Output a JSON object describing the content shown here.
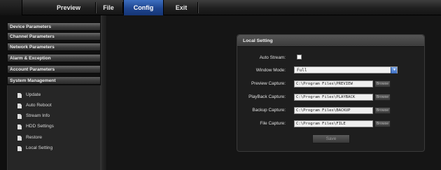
{
  "menu": {
    "items": [
      {
        "label": "Preview"
      },
      {
        "label": "File"
      },
      {
        "label": "Config",
        "active": true
      },
      {
        "label": "Exit"
      }
    ]
  },
  "sidebar": {
    "categories": [
      {
        "label": "Device Parameters"
      },
      {
        "label": "Channel Parameters"
      },
      {
        "label": "Network Parameters"
      },
      {
        "label": "Alarm & Exception"
      },
      {
        "label": "Account Parameters"
      },
      {
        "label": "System Management",
        "expanded": true
      }
    ],
    "items": [
      {
        "label": "Update"
      },
      {
        "label": "Auto Reboot"
      },
      {
        "label": "Stream Info"
      },
      {
        "label": "HDD Settings"
      },
      {
        "label": "Restore"
      },
      {
        "label": "Local Setting",
        "selected": true
      }
    ]
  },
  "local_setting": {
    "title": "Local Setting",
    "auto_stream_label": "Auto Stream:",
    "auto_stream_checked": false,
    "window_mode_label": "Window Mode:",
    "window_mode_value": "Full",
    "preview_capture_label": "Preview Capture:",
    "preview_capture_value": "C:\\Program Files\\PREVIEW",
    "playback_capture_label": "PlayBack Capture:",
    "playback_capture_value": "C:\\Program Files\\PLAYBACK",
    "backup_capture_label": "Backup Capture:",
    "backup_capture_value": "C:\\Program Files\\BACKUP",
    "file_capture_label": "File Capture:",
    "file_capture_value": "C:\\Program Files\\FILE",
    "browse_label": "Browse",
    "save_label": "Save"
  },
  "colors": {
    "accent": "#2a56a6",
    "background": "#151515",
    "panel": "#1e1e1e"
  }
}
